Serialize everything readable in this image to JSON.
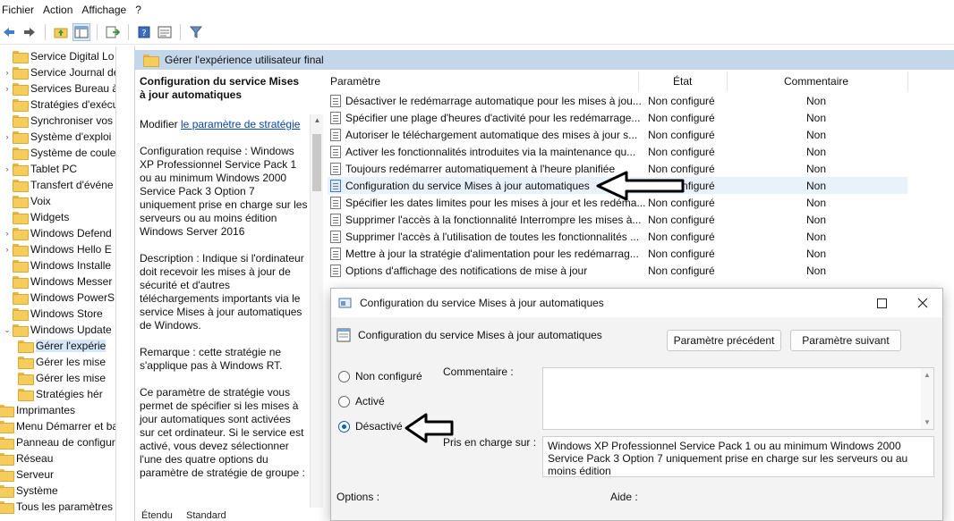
{
  "menu": [
    "Fichier",
    "Action",
    "Affichage",
    "?"
  ],
  "tree": {
    "items": [
      {
        "label": "Service Digital Lo",
        "chev": ""
      },
      {
        "label": "Service Journal de",
        "chev": "›"
      },
      {
        "label": "Services Bureau à",
        "chev": "›"
      },
      {
        "label": "Stratégies d'exécu",
        "chev": ""
      },
      {
        "label": "Synchroniser vos",
        "chev": ""
      },
      {
        "label": "Système d'exploi",
        "chev": "›"
      },
      {
        "label": "Système de coule",
        "chev": ""
      },
      {
        "label": "Tablet PC",
        "chev": "›"
      },
      {
        "label": "Transfert d'événe",
        "chev": ""
      },
      {
        "label": "Voix",
        "chev": ""
      },
      {
        "label": "Widgets",
        "chev": ""
      },
      {
        "label": "Windows Defend",
        "chev": "›"
      },
      {
        "label": "Windows Hello E",
        "chev": "›"
      },
      {
        "label": "Windows Installe",
        "chev": ""
      },
      {
        "label": "Windows Messer",
        "chev": ""
      },
      {
        "label": "Windows PowerS",
        "chev": ""
      },
      {
        "label": "Windows Store",
        "chev": ""
      },
      {
        "label": "Windows Update",
        "chev": "⌄"
      }
    ],
    "sub_items": [
      {
        "label": "Gérer l'expérie",
        "selected": true
      },
      {
        "label": "Gérer les mise",
        "selected": false
      },
      {
        "label": "Gérer les mise",
        "selected": false
      },
      {
        "label": "Stratégies hér",
        "selected": false
      }
    ],
    "root_items": [
      {
        "label": "Imprimantes"
      },
      {
        "label": "Menu Démarrer et ba"
      },
      {
        "label": "Panneau de configur"
      },
      {
        "label": "Réseau"
      },
      {
        "label": "Serveur"
      },
      {
        "label": "Système"
      },
      {
        "label": "Tous les paramètres"
      }
    ]
  },
  "header": {
    "title": "Gérer l'expérience utilisateur final"
  },
  "description": {
    "title": "Configuration du service Mises à jour automatiques",
    "edit_prefix": "Modifier ",
    "edit_link": "le paramètre de stratégie",
    "requirements": "Configuration requise : Windows XP Professionnel Service Pack 1 ou au minimum Windows 2000 Service Pack 3 Option 7 uniquement prise en charge sur les serveurs ou au moins édition Windows Server 2016",
    "description": "Description : Indique si l'ordinateur doit recevoir les mises à jour de sécurité et d'autres téléchargements importants via le service Mises à jour automatiques de Windows.",
    "note": "Remarque : cette stratégie ne s'applique pas à Windows RT.",
    "more": "Ce paramètre de stratégie vous permet de spécifier si les mises à jour automatiques sont activées sur cet ordinateur. Si le service est activé, vous devez sélectionner l'une des quatre options du paramètre de stratégie de groupe :"
  },
  "bottom_tabs": [
    "Étendu",
    "Standard"
  ],
  "columns": {
    "setting": "Paramètre",
    "state": "État",
    "comment": "Commentaire"
  },
  "rows": [
    {
      "name": "Désactiver le redémarrage automatique pour les mises à jou...",
      "state": "Non configuré",
      "comment": "Non"
    },
    {
      "name": "Spécifier une plage d'heures d'activité pour les redémarrage...",
      "state": "Non configuré",
      "comment": "Non"
    },
    {
      "name": "Autoriser le téléchargement automatique des mises à jour s...",
      "state": "Non configuré",
      "comment": "Non"
    },
    {
      "name": "Activer les fonctionnalités introduites via la maintenance qu...",
      "state": "Non configuré",
      "comment": "Non"
    },
    {
      "name": "Toujours redémarrer automatiquement à l'heure planifiée",
      "state": "Non configuré",
      "comment": "Non"
    },
    {
      "name": "Configuration du service Mises à jour automatiques",
      "state": "Non configuré",
      "comment": "Non",
      "highlight": true
    },
    {
      "name": "Spécifier les dates limites pour les mises à jour et les redéma...",
      "state": "Non configuré",
      "comment": "Non"
    },
    {
      "name": "Supprimer l'accès à la fonctionnalité Interrompre les mises à...",
      "state": "Non configuré",
      "comment": "Non"
    },
    {
      "name": "Supprimer l'accès à l'utilisation de toutes les fonctionnalités ...",
      "state": "Non configuré",
      "comment": "Non"
    },
    {
      "name": "Mettre à jour la stratégie d'alimentation pour les redémarrag...",
      "state": "Non configuré",
      "comment": "Non"
    },
    {
      "name": "Options d'affichage des notifications de mise à jour",
      "state": "Non configuré",
      "comment": "Non"
    }
  ],
  "dialog": {
    "title": "Configuration du service Mises à jour automatiques",
    "subtitle": "Configuration du service Mises à jour automatiques",
    "prev_button": "Paramètre précédent",
    "next_button": "Paramètre suivant",
    "radio_not_configured": "Non configuré",
    "radio_enabled": "Activé",
    "radio_disabled": "Désactivé",
    "selected": "Désactivé",
    "comment_label": "Commentaire :",
    "supported_label": "Pris en charge sur :",
    "supported_text": "Windows XP Professionnel Service Pack 1 ou au minimum Windows 2000 Service Pack 3 Option 7 uniquement prise en charge sur les serveurs ou au moins édition",
    "options_label": "Options :",
    "help_label": "Aide :"
  }
}
